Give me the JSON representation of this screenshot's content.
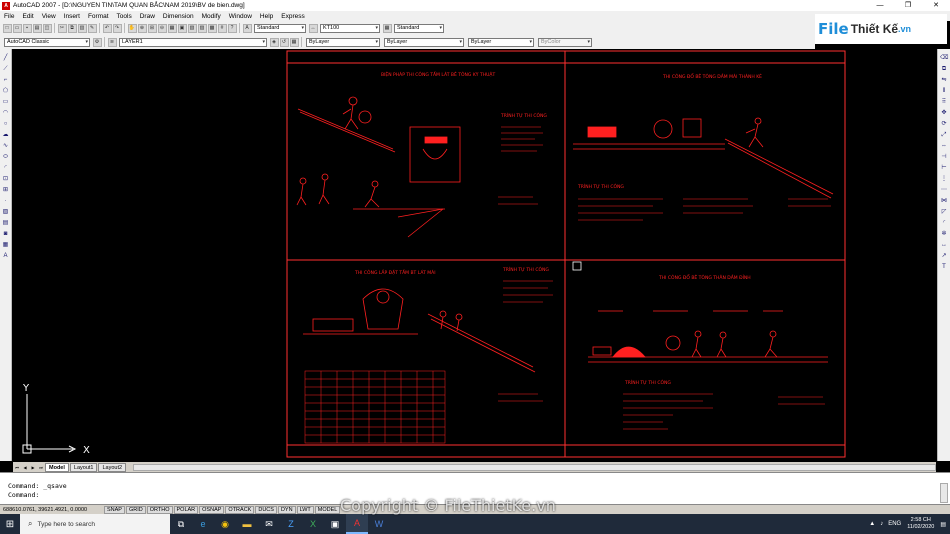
{
  "window": {
    "title": "AutoCAD 2007 - [D:\\NGUYEN TIN\\TAM QUAN BẮC\\NAM 2019\\BV de bien.dwg]",
    "controls": [
      "—",
      "❐",
      "✕"
    ]
  },
  "menu": [
    "File",
    "Edit",
    "View",
    "Insert",
    "Format",
    "Tools",
    "Draw",
    "Dimension",
    "Modify",
    "Window",
    "Help",
    "Express"
  ],
  "toolbar": {
    "text_style": "Standard",
    "dim_style": "KT100",
    "table_style": "Standard",
    "workspace": "AutoCAD Classic",
    "layer": "LAYER1",
    "color": "ByLayer",
    "linetype": "ByLayer",
    "lineweight": "ByLayer",
    "plotstyle": "ByColor"
  },
  "logo": {
    "part1": "File",
    "part2": "Thiết Kế",
    "part3": ".vn"
  },
  "drawing": {
    "panels": [
      {
        "title": "BIỆN PHÁP THI CÔNG TẤM LÁT BÊ TÔNG KỸ THUẬT",
        "subtitle": "TRÌNH TỰ THI CÔNG"
      },
      {
        "title": "THI CÔNG ĐỔ BÊ TÔNG DẦM MÁI THÀNH KÈ",
        "subtitle": "TRÌNH TỰ THI CÔNG"
      },
      {
        "title": "THI CÔNG LẮP ĐẶT TẤM BT LÁT MÁI",
        "subtitle": "TRÌNH TỰ THI CÔNG"
      },
      {
        "title": "THI CÔNG ĐỔ BÊ TÔNG THÂN DẦM ĐỈNH",
        "subtitle": "TRÌNH TỰ THI CÔNG"
      }
    ],
    "ucs_x": "X",
    "ucs_y": "Y"
  },
  "tabs": [
    "Model",
    "Layout1",
    "Layout2"
  ],
  "command": {
    "line1": "Command: _qsave",
    "line2": "Command:"
  },
  "status": {
    "coords": "688610.0761, 39621.4921, 0.0000",
    "toggles": [
      "SNAP",
      "GRID",
      "ORTHO",
      "POLAR",
      "OSNAP",
      "OTRACK",
      "DUCS",
      "DYN",
      "LWT",
      "MODEL"
    ]
  },
  "taskbar": {
    "search_placeholder": "Type here to search",
    "lang": "ENG",
    "time": "2:58 CH",
    "date": "11/02/2020"
  },
  "watermark": "Copyright © FileThietKe.vn",
  "colors": {
    "drawing": "#ff2020",
    "frame": "#ff3030",
    "canvas": "#000000",
    "accent": "#1f8ed8"
  }
}
